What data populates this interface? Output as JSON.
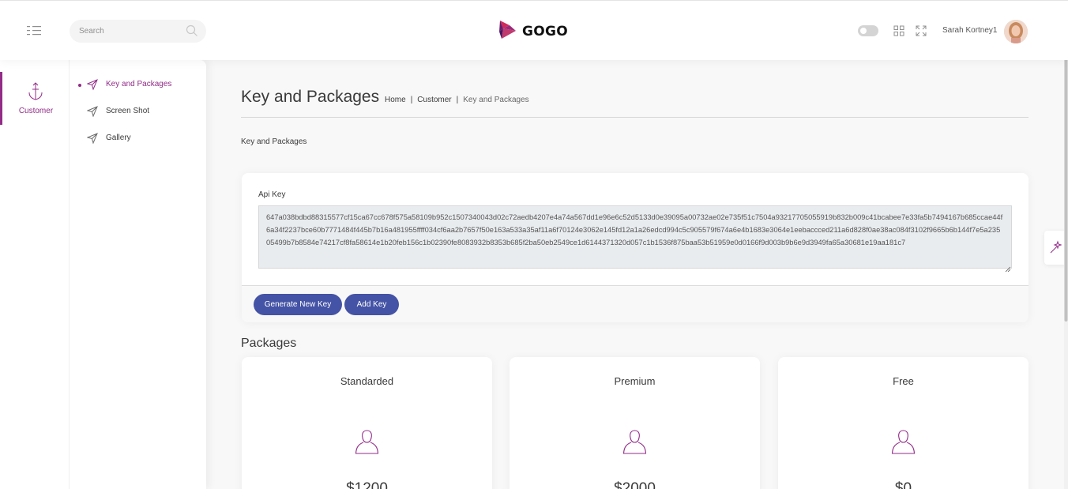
{
  "navbar": {
    "search_placeholder": "Search",
    "logo_text": "GOGO",
    "user_name": "Sarah Kortney1"
  },
  "main_menu": {
    "items": [
      {
        "label": "Customer",
        "icon": "anchor-icon",
        "active": true
      }
    ]
  },
  "sub_menu": {
    "items": [
      {
        "label": "Key and Packages",
        "icon": "paper-plane-icon",
        "active": true
      },
      {
        "label": "Screen Shot",
        "icon": "paper-plane-icon",
        "active": false
      },
      {
        "label": "Gallery",
        "icon": "paper-plane-icon",
        "active": false
      }
    ]
  },
  "page": {
    "title": "Key and Packages",
    "breadcrumb": [
      "Home",
      "Customer",
      "Key and Packages"
    ],
    "section_label": "Key and Packages"
  },
  "api": {
    "label": "Api Key",
    "key": "647a038bdbd88315577cf15ca67cc678f575a58109b952c1507340043d02c72aedb4207e4a74a567dd1e96e6c52d5133d0e39095a00732ae02e735f51c7504a93217705055919b832b009c41bcabee7e33fa5b7494167b685ccae44f6a34f2237bce60b7771484f445b7b16a481955ffff034cf6aa2b7657f50e163a533a35af11a6f70124e3062e145fd12a1a26edcd994c5c905579f674a6e4b1683e3064e1eebaccced211a6d828f0ae38ac084f3102f9665b6b144f7e5a23505499b7b8584e74217cf8fa58614e1b20feb156c1b02390fe8083932b8353b685f2ba50eb2549ce1d6144371320d057c1b1536f875baa53b51959e0d0166f9d003b9b6e9d3949fa65a30681e19aa181c7",
    "buttons": {
      "generate": "Generate New Key",
      "add": "Add Key"
    }
  },
  "packages": {
    "title": "Packages",
    "items": [
      {
        "name": "Standarded",
        "price": "$1200",
        "icon": "user-icon"
      },
      {
        "name": "Premium",
        "price": "$2000",
        "icon": "user-icon"
      },
      {
        "name": "Free",
        "price": "$0",
        "icon": "user-icon"
      }
    ]
  },
  "colors": {
    "accent": "#922c88",
    "button": "#4453a5"
  }
}
